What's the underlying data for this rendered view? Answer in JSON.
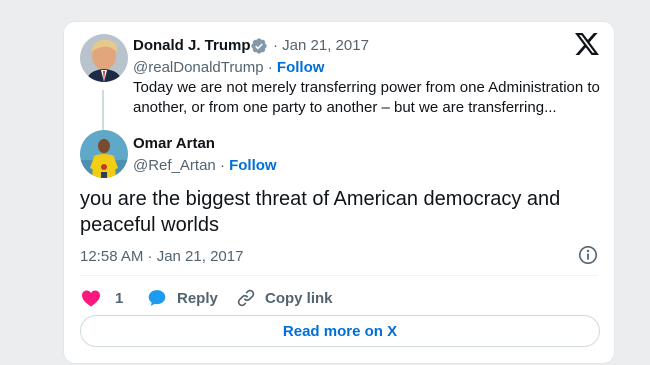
{
  "quoted_tweet": {
    "author_name": "Donald J. Trump",
    "handle": "@realDonaldTrump",
    "separator": "·",
    "follow_label": "Follow",
    "date": "Jan 21, 2017",
    "text": "Today we are not merely transferring power from one Administration to another, or from one party to another – but we are transferring..."
  },
  "tweet": {
    "author_name": "Omar Artan",
    "handle": "@Ref_Artan",
    "separator": "·",
    "follow_label": "Follow",
    "text": "you are the biggest threat of American democracy and peaceful worlds",
    "timestamp": "12:58 AM · Jan 21, 2017"
  },
  "actions": {
    "like_count": "1",
    "reply_label": "Reply",
    "copy_link_label": "Copy link"
  },
  "read_more_label": "Read more on X",
  "icons": {
    "verified": "verified-badge-icon",
    "logo": "x-logo-icon",
    "info": "info-icon",
    "heart": "heart-icon",
    "reply": "speech-bubble-icon",
    "link": "link-icon"
  },
  "colors": {
    "accent": "#006fd6",
    "heart": "#f91880",
    "reply_bubble": "#1d9bf0",
    "muted": "#536471"
  }
}
